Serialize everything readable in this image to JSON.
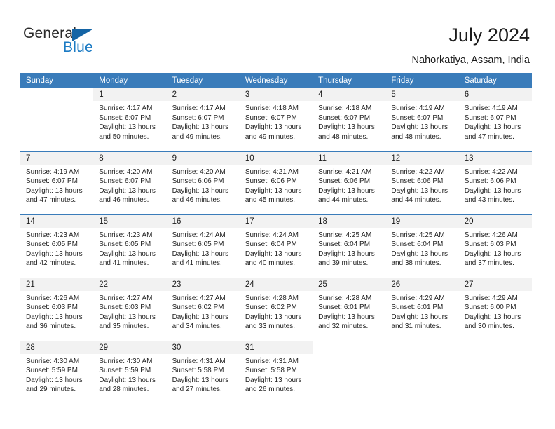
{
  "brand": {
    "name_top": "General",
    "name_bottom": "Blue",
    "accent_color": "#1c7bc4",
    "triangle_color": "#1464a5"
  },
  "header": {
    "title": "July 2024",
    "subtitle": "Nahorkatiya, Assam, India",
    "header_bg": "#3a7cba",
    "header_text_color": "#ffffff",
    "daynum_bg": "#f2f2f2"
  },
  "weekdays": [
    "Sunday",
    "Monday",
    "Tuesday",
    "Wednesday",
    "Thursday",
    "Friday",
    "Saturday"
  ],
  "weeks": [
    [
      {
        "day": "",
        "sunrise": "",
        "sunset": "",
        "daylight1": "",
        "daylight2": "",
        "blank": true
      },
      {
        "day": "1",
        "sunrise": "Sunrise: 4:17 AM",
        "sunset": "Sunset: 6:07 PM",
        "daylight1": "Daylight: 13 hours",
        "daylight2": "and 50 minutes."
      },
      {
        "day": "2",
        "sunrise": "Sunrise: 4:17 AM",
        "sunset": "Sunset: 6:07 PM",
        "daylight1": "Daylight: 13 hours",
        "daylight2": "and 49 minutes."
      },
      {
        "day": "3",
        "sunrise": "Sunrise: 4:18 AM",
        "sunset": "Sunset: 6:07 PM",
        "daylight1": "Daylight: 13 hours",
        "daylight2": "and 49 minutes."
      },
      {
        "day": "4",
        "sunrise": "Sunrise: 4:18 AM",
        "sunset": "Sunset: 6:07 PM",
        "daylight1": "Daylight: 13 hours",
        "daylight2": "and 48 minutes."
      },
      {
        "day": "5",
        "sunrise": "Sunrise: 4:19 AM",
        "sunset": "Sunset: 6:07 PM",
        "daylight1": "Daylight: 13 hours",
        "daylight2": "and 48 minutes."
      },
      {
        "day": "6",
        "sunrise": "Sunrise: 4:19 AM",
        "sunset": "Sunset: 6:07 PM",
        "daylight1": "Daylight: 13 hours",
        "daylight2": "and 47 minutes."
      }
    ],
    [
      {
        "day": "7",
        "sunrise": "Sunrise: 4:19 AM",
        "sunset": "Sunset: 6:07 PM",
        "daylight1": "Daylight: 13 hours",
        "daylight2": "and 47 minutes."
      },
      {
        "day": "8",
        "sunrise": "Sunrise: 4:20 AM",
        "sunset": "Sunset: 6:07 PM",
        "daylight1": "Daylight: 13 hours",
        "daylight2": "and 46 minutes."
      },
      {
        "day": "9",
        "sunrise": "Sunrise: 4:20 AM",
        "sunset": "Sunset: 6:06 PM",
        "daylight1": "Daylight: 13 hours",
        "daylight2": "and 46 minutes."
      },
      {
        "day": "10",
        "sunrise": "Sunrise: 4:21 AM",
        "sunset": "Sunset: 6:06 PM",
        "daylight1": "Daylight: 13 hours",
        "daylight2": "and 45 minutes."
      },
      {
        "day": "11",
        "sunrise": "Sunrise: 4:21 AM",
        "sunset": "Sunset: 6:06 PM",
        "daylight1": "Daylight: 13 hours",
        "daylight2": "and 44 minutes."
      },
      {
        "day": "12",
        "sunrise": "Sunrise: 4:22 AM",
        "sunset": "Sunset: 6:06 PM",
        "daylight1": "Daylight: 13 hours",
        "daylight2": "and 44 minutes."
      },
      {
        "day": "13",
        "sunrise": "Sunrise: 4:22 AM",
        "sunset": "Sunset: 6:06 PM",
        "daylight1": "Daylight: 13 hours",
        "daylight2": "and 43 minutes."
      }
    ],
    [
      {
        "day": "14",
        "sunrise": "Sunrise: 4:23 AM",
        "sunset": "Sunset: 6:05 PM",
        "daylight1": "Daylight: 13 hours",
        "daylight2": "and 42 minutes."
      },
      {
        "day": "15",
        "sunrise": "Sunrise: 4:23 AM",
        "sunset": "Sunset: 6:05 PM",
        "daylight1": "Daylight: 13 hours",
        "daylight2": "and 41 minutes."
      },
      {
        "day": "16",
        "sunrise": "Sunrise: 4:24 AM",
        "sunset": "Sunset: 6:05 PM",
        "daylight1": "Daylight: 13 hours",
        "daylight2": "and 41 minutes."
      },
      {
        "day": "17",
        "sunrise": "Sunrise: 4:24 AM",
        "sunset": "Sunset: 6:04 PM",
        "daylight1": "Daylight: 13 hours",
        "daylight2": "and 40 minutes."
      },
      {
        "day": "18",
        "sunrise": "Sunrise: 4:25 AM",
        "sunset": "Sunset: 6:04 PM",
        "daylight1": "Daylight: 13 hours",
        "daylight2": "and 39 minutes."
      },
      {
        "day": "19",
        "sunrise": "Sunrise: 4:25 AM",
        "sunset": "Sunset: 6:04 PM",
        "daylight1": "Daylight: 13 hours",
        "daylight2": "and 38 minutes."
      },
      {
        "day": "20",
        "sunrise": "Sunrise: 4:26 AM",
        "sunset": "Sunset: 6:03 PM",
        "daylight1": "Daylight: 13 hours",
        "daylight2": "and 37 minutes."
      }
    ],
    [
      {
        "day": "21",
        "sunrise": "Sunrise: 4:26 AM",
        "sunset": "Sunset: 6:03 PM",
        "daylight1": "Daylight: 13 hours",
        "daylight2": "and 36 minutes."
      },
      {
        "day": "22",
        "sunrise": "Sunrise: 4:27 AM",
        "sunset": "Sunset: 6:03 PM",
        "daylight1": "Daylight: 13 hours",
        "daylight2": "and 35 minutes."
      },
      {
        "day": "23",
        "sunrise": "Sunrise: 4:27 AM",
        "sunset": "Sunset: 6:02 PM",
        "daylight1": "Daylight: 13 hours",
        "daylight2": "and 34 minutes."
      },
      {
        "day": "24",
        "sunrise": "Sunrise: 4:28 AM",
        "sunset": "Sunset: 6:02 PM",
        "daylight1": "Daylight: 13 hours",
        "daylight2": "and 33 minutes."
      },
      {
        "day": "25",
        "sunrise": "Sunrise: 4:28 AM",
        "sunset": "Sunset: 6:01 PM",
        "daylight1": "Daylight: 13 hours",
        "daylight2": "and 32 minutes."
      },
      {
        "day": "26",
        "sunrise": "Sunrise: 4:29 AM",
        "sunset": "Sunset: 6:01 PM",
        "daylight1": "Daylight: 13 hours",
        "daylight2": "and 31 minutes."
      },
      {
        "day": "27",
        "sunrise": "Sunrise: 4:29 AM",
        "sunset": "Sunset: 6:00 PM",
        "daylight1": "Daylight: 13 hours",
        "daylight2": "and 30 minutes."
      }
    ],
    [
      {
        "day": "28",
        "sunrise": "Sunrise: 4:30 AM",
        "sunset": "Sunset: 5:59 PM",
        "daylight1": "Daylight: 13 hours",
        "daylight2": "and 29 minutes."
      },
      {
        "day": "29",
        "sunrise": "Sunrise: 4:30 AM",
        "sunset": "Sunset: 5:59 PM",
        "daylight1": "Daylight: 13 hours",
        "daylight2": "and 28 minutes."
      },
      {
        "day": "30",
        "sunrise": "Sunrise: 4:31 AM",
        "sunset": "Sunset: 5:58 PM",
        "daylight1": "Daylight: 13 hours",
        "daylight2": "and 27 minutes."
      },
      {
        "day": "31",
        "sunrise": "Sunrise: 4:31 AM",
        "sunset": "Sunset: 5:58 PM",
        "daylight1": "Daylight: 13 hours",
        "daylight2": "and 26 minutes."
      },
      {
        "day": "",
        "sunrise": "",
        "sunset": "",
        "daylight1": "",
        "daylight2": "",
        "blank": true
      },
      {
        "day": "",
        "sunrise": "",
        "sunset": "",
        "daylight1": "",
        "daylight2": "",
        "blank": true
      },
      {
        "day": "",
        "sunrise": "",
        "sunset": "",
        "daylight1": "",
        "daylight2": "",
        "blank": true
      }
    ]
  ]
}
